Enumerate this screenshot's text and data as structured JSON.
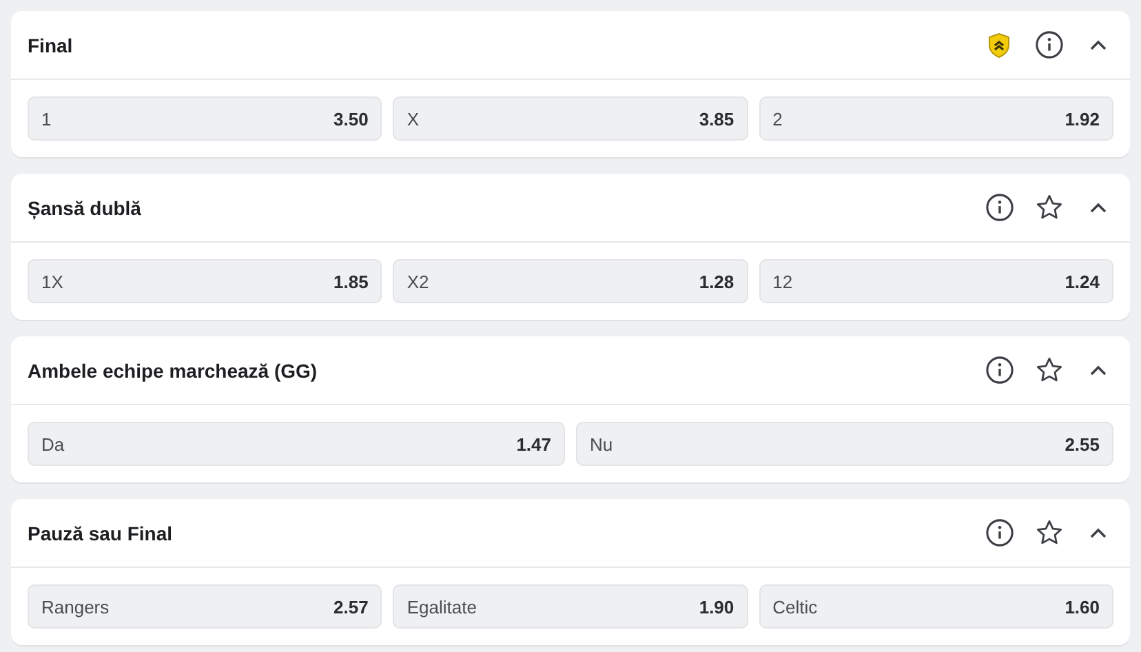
{
  "markets": [
    {
      "title": "Final",
      "expanded": true,
      "icons": [
        {
          "kind": "boost"
        },
        {
          "kind": "info"
        }
      ],
      "outcomes": [
        {
          "label": "1",
          "odds": "3.50"
        },
        {
          "label": "X",
          "odds": "3.85"
        },
        {
          "label": "2",
          "odds": "1.92"
        }
      ]
    },
    {
      "title": "Șansă dublă",
      "expanded": true,
      "icons": [
        {
          "kind": "info"
        },
        {
          "kind": "favorite"
        }
      ],
      "outcomes": [
        {
          "label": "1X",
          "odds": "1.85"
        },
        {
          "label": "X2",
          "odds": "1.28"
        },
        {
          "label": "12",
          "odds": "1.24"
        }
      ]
    },
    {
      "title": "Ambele echipe marchează (GG)",
      "expanded": true,
      "icons": [
        {
          "kind": "info"
        },
        {
          "kind": "favorite"
        }
      ],
      "outcomes": [
        {
          "label": "Da",
          "odds": "1.47"
        },
        {
          "label": "Nu",
          "odds": "2.55"
        }
      ]
    },
    {
      "title": "Pauză sau Final",
      "expanded": true,
      "icons": [
        {
          "kind": "info"
        },
        {
          "kind": "favorite"
        }
      ],
      "outcomes": [
        {
          "label": "Rangers",
          "odds": "2.57"
        },
        {
          "label": "Egalitate",
          "odds": "1.90"
        },
        {
          "label": "Celtic",
          "odds": "1.60"
        }
      ]
    }
  ]
}
